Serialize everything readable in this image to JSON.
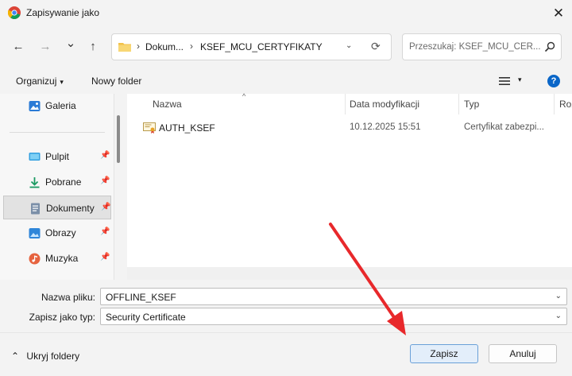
{
  "window": {
    "title": "Zapisywanie jako",
    "close_symbol": "✕"
  },
  "nav": {
    "back_symbol": "←",
    "forward_symbol": "→",
    "recent_symbol": "⌄",
    "up_symbol": "↑",
    "breadcrumb_root_sep": "›",
    "breadcrumbs": [
      "Dokum...",
      "KSEF_MCU_CERTYFIKATY"
    ],
    "breadcrumb_sep": "›",
    "address_dropdown": "⌄",
    "refresh_symbol": "⟳",
    "search_placeholder": "Przeszukaj: KSEF_MCU_CER..."
  },
  "toolbar": {
    "organize_label": "Organizuj",
    "organize_caret": "▾",
    "new_folder_label": "Nowy folder",
    "view_caret": "▾",
    "help_symbol": "?"
  },
  "sidebar": {
    "items": [
      {
        "label": "Galeria",
        "icon": "gallery-icon",
        "pinned": false,
        "selected": false
      },
      {
        "label": "Pulpit",
        "icon": "desktop-icon",
        "pinned": true,
        "selected": false
      },
      {
        "label": "Pobrane",
        "icon": "downloads-icon",
        "pinned": true,
        "selected": false
      },
      {
        "label": "Dokumenty",
        "icon": "documents-icon",
        "pinned": true,
        "selected": true
      },
      {
        "label": "Obrazy",
        "icon": "pictures-icon",
        "pinned": true,
        "selected": false
      },
      {
        "label": "Muzyka",
        "icon": "music-icon",
        "pinned": true,
        "selected": false
      }
    ],
    "pin_symbol": "📌"
  },
  "filelist": {
    "sort_symbol": "^",
    "columns": {
      "name": "Nazwa",
      "date": "Data modyfikacji",
      "type": "Typ",
      "size": "Roz"
    },
    "rows": [
      {
        "name": "AUTH_KSEF",
        "date": "10.12.2025 15:51",
        "type": "Certyfikat zabezpi..."
      }
    ]
  },
  "form": {
    "filename_label": "Nazwa pliku:",
    "filename_value": "OFFLINE_KSEF",
    "filetype_label": "Zapisz jako typ:",
    "filetype_value": "Security Certificate",
    "dropdown_symbol": "⌄"
  },
  "footer": {
    "hide_folders_symbol": "⌃",
    "hide_folders_label": "Ukryj foldery",
    "save_label": "Zapisz",
    "cancel_label": "Anuluj"
  },
  "colors": {
    "accent": "#0a66c8",
    "annotation_arrow": "#e8282b",
    "primary_button_bg": "#e3eefa"
  }
}
